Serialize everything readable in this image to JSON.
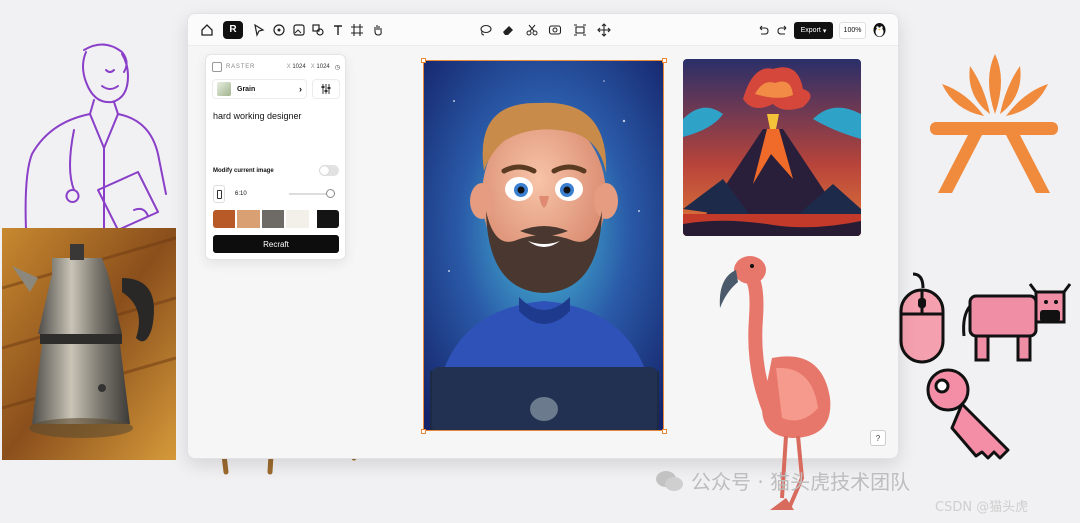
{
  "toolbar": {
    "tools": [
      "home-icon",
      "brand-menu-icon",
      "select-icon",
      "style-icon",
      "image-icon",
      "shapes-icon",
      "text-icon",
      "frame-icon",
      "hand-icon"
    ],
    "actions": [
      "lasso-icon",
      "eraser-icon",
      "scissors-icon",
      "vectorize-icon",
      "expand-icon",
      "move-icon"
    ],
    "export_label": "Export",
    "zoom": "100%"
  },
  "panel": {
    "title": "RASTER",
    "width_prefix": "X",
    "width": "1024",
    "height_prefix": "X",
    "height": "1024",
    "style_name": "Grain",
    "prompt": "hard working designer",
    "modify_label": "Modify current image",
    "ratio": "6:10",
    "palette": [
      "#b85a28",
      "#d9a073",
      "#6e6b66",
      "#f3f0ea",
      "#141414"
    ],
    "button": "Recraft"
  },
  "help": "?",
  "watermark": {
    "text": "公众号 · 猫头虎技术团队",
    "csdn": "CSDN @猫头虎"
  },
  "colors": {
    "accent_orange": "#f08a3c",
    "outline_purple": "#8a3fc9",
    "selection": "#e8893a"
  }
}
